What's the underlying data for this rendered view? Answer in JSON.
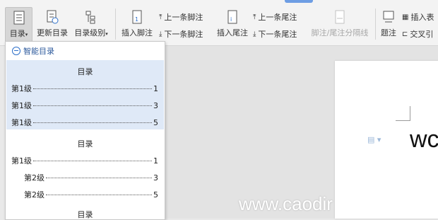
{
  "ribbon": {
    "toc_label": "目录",
    "update_toc_label": "更新目录",
    "toc_level_label": "目录级别",
    "insert_footnote_label": "插入脚注",
    "prev_footnote_label": "上一条脚注",
    "next_footnote_label": "下一条脚注",
    "insert_endnote_label": "插入尾注",
    "prev_endnote_label": "上一条尾注",
    "next_endnote_label": "下一条尾注",
    "separator_label": "脚注/尾注分隔线",
    "caption_label": "题注",
    "insert_table_label": "插入表",
    "cross_ref_label": "交叉引"
  },
  "dropdown": {
    "smart_label": "智能目录",
    "blocks": [
      {
        "title": "目录",
        "lines": [
          {
            "text": "第1级",
            "page": "1"
          },
          {
            "text": "第1级",
            "page": "3"
          },
          {
            "text": "第1级",
            "page": "5"
          }
        ]
      },
      {
        "title": "目录",
        "lines": [
          {
            "text": "第1级",
            "page": "1"
          },
          {
            "text": "第2级",
            "page": "3"
          },
          {
            "text": "第2级",
            "page": "5"
          }
        ]
      },
      {
        "title": "目录",
        "lines": []
      }
    ]
  },
  "document": {
    "visible_text": "wc",
    "watermark": "www.caodir"
  }
}
